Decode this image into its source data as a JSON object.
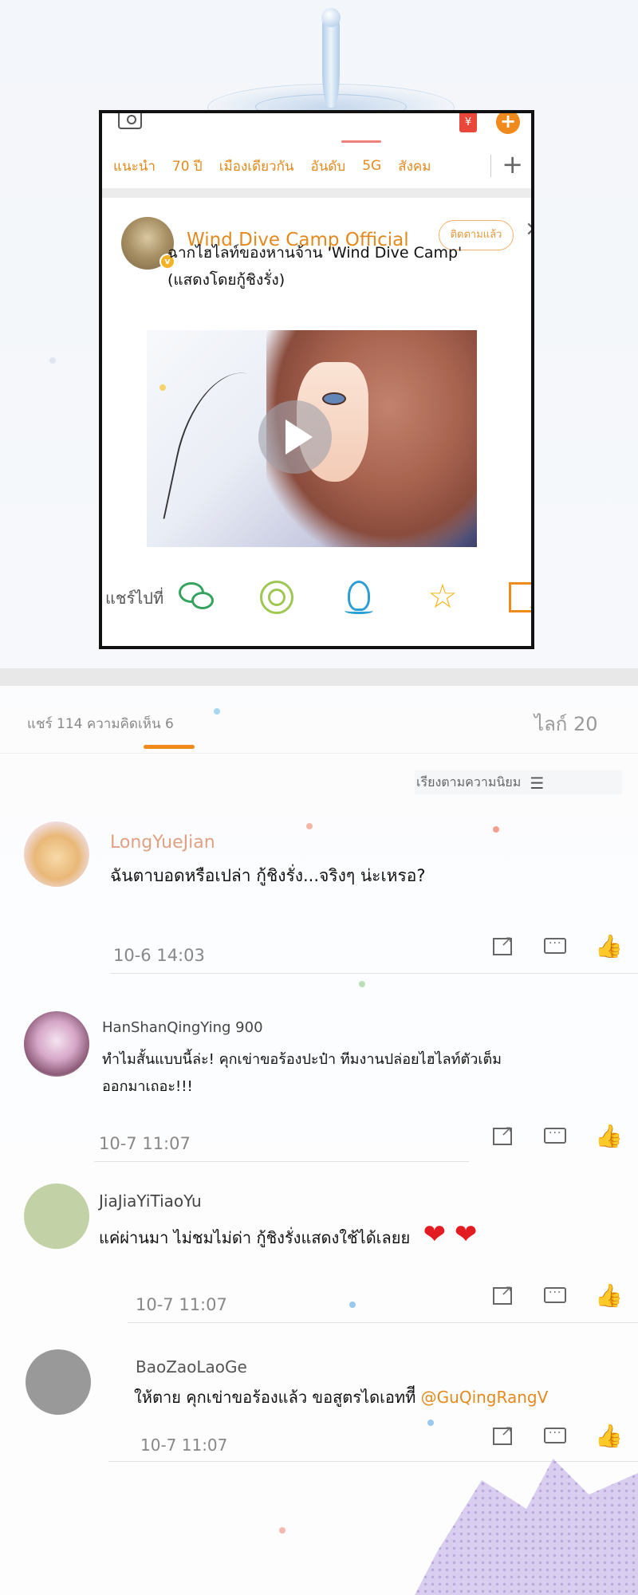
{
  "header": {
    "money_icon_label": "¥",
    "plus_label": "+"
  },
  "nav": {
    "items": [
      "แนะนำ",
      "70 ปี",
      "เมืองเดียวกัน",
      "อันดับ",
      "5G",
      "สังคม"
    ],
    "add_label": "+"
  },
  "post": {
    "author": "Wind Dive Camp Official",
    "verified_label": "v",
    "follow_label": "ติดตามแล้ว",
    "close_label": "×",
    "text_line1": "ฉากไฮไลท์ของหานจ้าน 'Wind Dive Camp'",
    "text_line2": "(แสดงโดยกู้ชิงรั่ง)"
  },
  "share": {
    "label": "แชร์ไปที่",
    "icons": [
      "wechat-icon",
      "moments-icon",
      "qq-icon",
      "qzone-icon",
      "save-icon"
    ],
    "qzone_glyph": "☆"
  },
  "stats": {
    "summary": "แชร์ 114 ความคิดเห็น 6",
    "likes": "ไลก์ 20",
    "sort_label": "เรียงตามความนิยม",
    "sort_glyph": "☰"
  },
  "comments": [
    {
      "user": "LongYueJian",
      "text": "ฉันตาบอดหรือเปล่า กู้ชิงรั่ง...จริงๆ น่ะเหรอ?",
      "time": "10-6 14:03"
    },
    {
      "user": "HanShanQingYing 900",
      "text_line1": "ทำไมสั้นแบบนี้ล่ะ! คุกเข่าขอร้องปะป๋า ทีมงานปล่อยไฮไลท์ตัวเต็ม",
      "text_line2": "ออกมาเถอะ!!!",
      "time": "10-7 11:07"
    },
    {
      "user": "JiaJiaYiTiaoYu",
      "text": "แค่ผ่านมา ไม่ชมไม่ด่า กู้ชิงรั่งแสดงใช้ได้เลยย",
      "hearts": "❤  ❤",
      "time": "10-7 11:07"
    },
    {
      "user": "BaoZaoLaoGe",
      "text": "ให้ตาย คุกเข่าขอร้องแล้ว ขอสูตรไดเอททีี",
      "mention": "@GuQingRangV",
      "time": "10-7 11:07"
    }
  ],
  "actions": {
    "reply_glyph": "↗",
    "comment_glyph": "···",
    "like_glyph": "👍"
  },
  "colors": {
    "accent": "#e38a1e",
    "green": "#35a35f",
    "qq_blue": "#2d9fd4",
    "heart_red": "#e31b23"
  }
}
